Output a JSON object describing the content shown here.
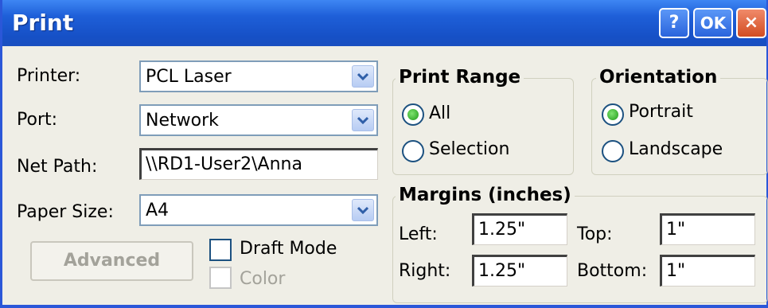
{
  "window": {
    "title": "Print"
  },
  "titlebar_buttons": {
    "help": "?",
    "ok": "OK",
    "close": "×"
  },
  "fields": {
    "printer": {
      "label": "Printer:",
      "value": "PCL Laser"
    },
    "port": {
      "label": "Port:",
      "value": "Network"
    },
    "net_path": {
      "label": "Net Path:",
      "value": "\\\\RD1-User2\\Anna"
    },
    "paper_size": {
      "label": "Paper Size:",
      "value": "A4"
    }
  },
  "advanced_button": "Advanced",
  "draft_mode": {
    "label": "Draft Mode",
    "checked": false
  },
  "color": {
    "label": "Color",
    "checked": false,
    "enabled": false
  },
  "print_range": {
    "title": "Print Range",
    "options": [
      {
        "label": "All",
        "selected": true
      },
      {
        "label": "Selection",
        "selected": false
      }
    ]
  },
  "orientation": {
    "title": "Orientation",
    "options": [
      {
        "label": "Portrait",
        "selected": true
      },
      {
        "label": "Landscape",
        "selected": false
      }
    ]
  },
  "margins": {
    "title": "Margins (inches)",
    "left": {
      "label": "Left:",
      "value": "1.25\""
    },
    "right": {
      "label": "Right:",
      "value": "1.25\""
    },
    "top": {
      "label": "Top:",
      "value": "1\""
    },
    "bottom": {
      "label": "Bottom:",
      "value": "1\""
    }
  },
  "icons": {
    "dropdown": "chevron-down-icon",
    "help": "question-icon",
    "close": "close-icon"
  },
  "colors": {
    "titlebar": "#1e5fd8",
    "window_bg": "#efeee6",
    "close": "#d24d22",
    "radio_fill": "#1f9a18"
  }
}
